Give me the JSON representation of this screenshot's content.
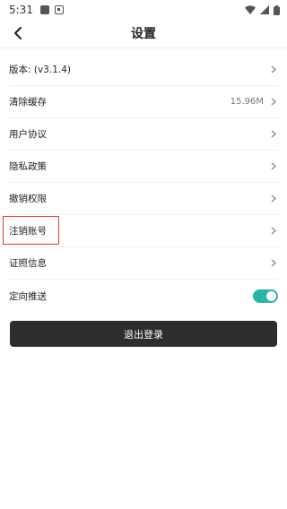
{
  "status_bar": {
    "time": "5:31"
  },
  "header": {
    "title": "设置"
  },
  "settings": {
    "version": {
      "label": "版本: (v3.1.4)"
    },
    "clear_cache": {
      "label": "清除缓存",
      "value": "15.96M"
    },
    "user_agreement": {
      "label": "用户协议"
    },
    "privacy_policy": {
      "label": "隐私政策"
    },
    "revoke_permissions": {
      "label": "撤销权限"
    },
    "delete_account": {
      "label": "注销账号"
    },
    "certificates": {
      "label": "证照信息"
    },
    "targeted_push": {
      "label": "定向推送",
      "enabled": true
    }
  },
  "logout_button": {
    "label": "退出登录"
  },
  "colors": {
    "toggle_on": "#2bb3a6",
    "button_bg": "#2d2d2d",
    "highlight": "#e33a34"
  }
}
